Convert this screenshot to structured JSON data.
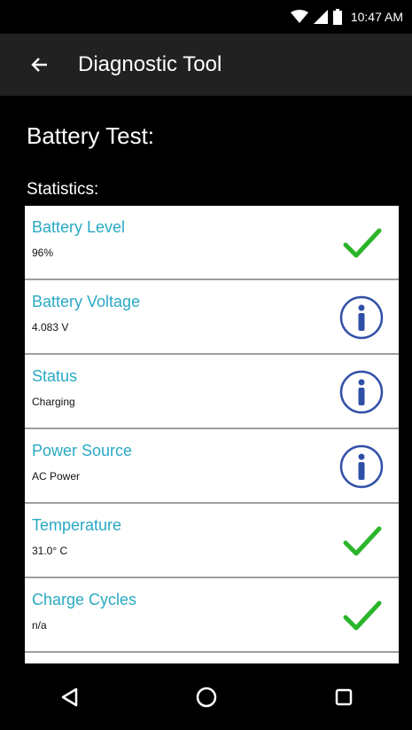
{
  "status_bar": {
    "time": "10:47 AM",
    "icons": [
      "wifi-icon",
      "signal-icon",
      "battery-icon"
    ]
  },
  "toolbar": {
    "title": "Diagnostic Tool",
    "back_icon": "arrow-left-icon"
  },
  "main": {
    "section_title": "Battery Test:",
    "stats_label": "Statistics:",
    "stats": [
      {
        "name": "Battery Level",
        "value": "96%",
        "icon": "check-icon"
      },
      {
        "name": "Battery Voltage",
        "value": "4.083 V",
        "icon": "info-icon"
      },
      {
        "name": "Status",
        "value": "Charging",
        "icon": "info-icon"
      },
      {
        "name": "Power Source",
        "value": "AC Power",
        "icon": "info-icon"
      },
      {
        "name": "Temperature",
        "value": "31.0° C",
        "icon": "check-icon"
      },
      {
        "name": "Charge Cycles",
        "value": "n/a",
        "icon": "check-icon"
      }
    ]
  },
  "nav_bar": {
    "buttons": [
      "back-triangle-icon",
      "home-circle-icon",
      "recents-square-icon"
    ]
  },
  "colors": {
    "accent_text": "#29a9c4",
    "check_green": "#2bb52b",
    "info_blue": "#3050a8",
    "toolbar_bg": "#212121"
  }
}
